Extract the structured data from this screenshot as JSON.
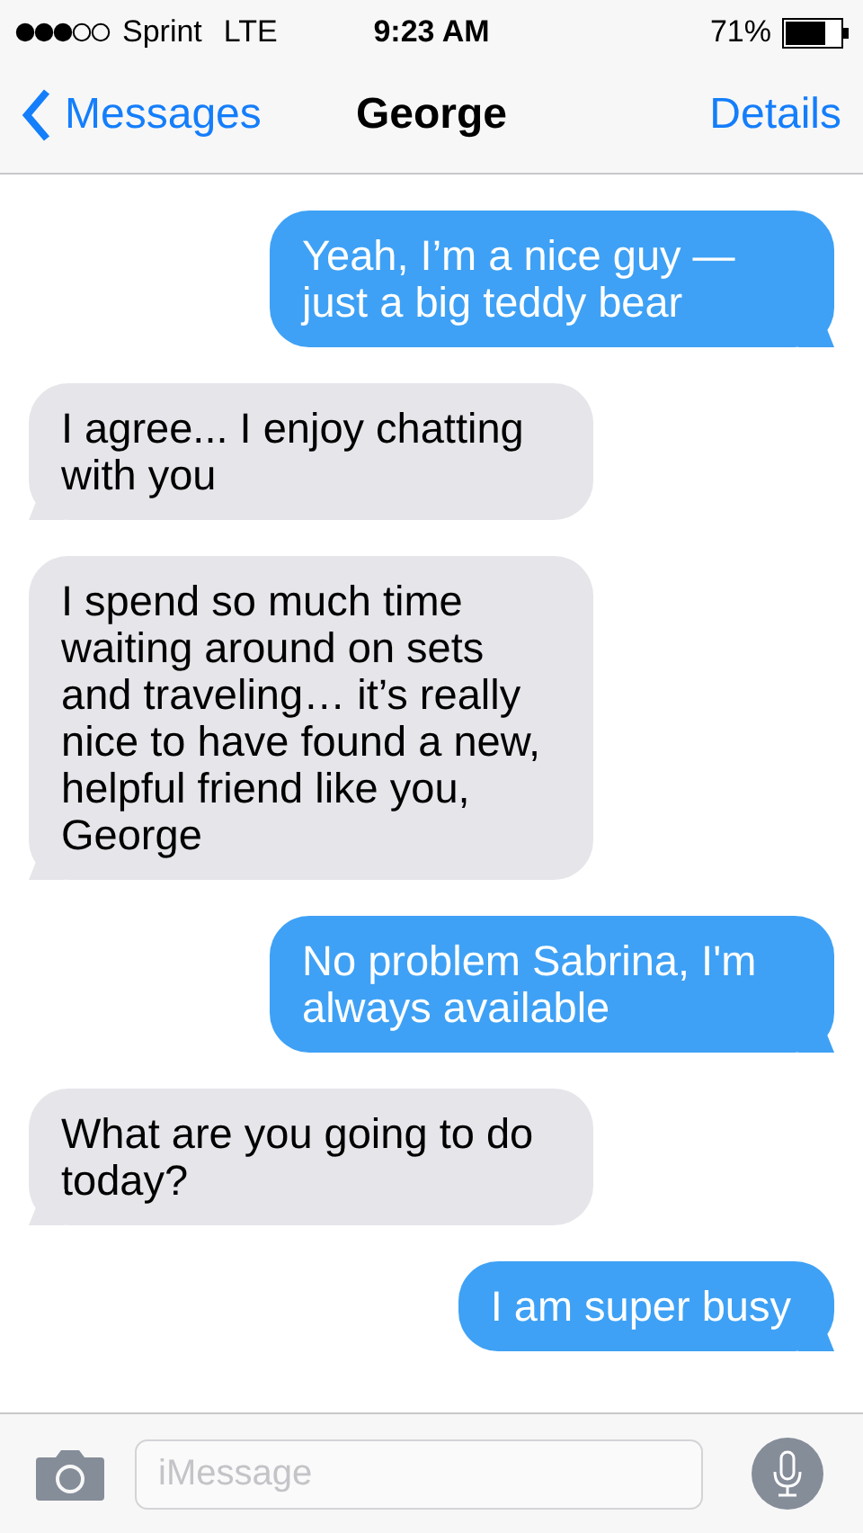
{
  "status_bar": {
    "carrier": "Sprint",
    "network": "LTE",
    "time": "9:23 AM",
    "battery": "71%"
  },
  "nav_bar": {
    "back": "Messages",
    "title": "George",
    "action": "Details"
  },
  "messages": [
    {
      "kind": "sent",
      "text": "Yeah, I’m a nice guy — just a big teddy bear"
    },
    {
      "kind": "received",
      "text": "I agree... I enjoy chatting with you"
    },
    {
      "kind": "received",
      "text": "I spend so much time waiting around on sets and traveling… it’s really nice to have found a new, helpful friend like you, George"
    },
    {
      "kind": "sent",
      "text": "No problem Sabrina, I'm always available"
    },
    {
      "kind": "received",
      "text": "What are you going to do today?"
    },
    {
      "kind": "sent",
      "text": "I am super busy"
    }
  ],
  "input_bar": {
    "placeholder": "iMessage"
  }
}
